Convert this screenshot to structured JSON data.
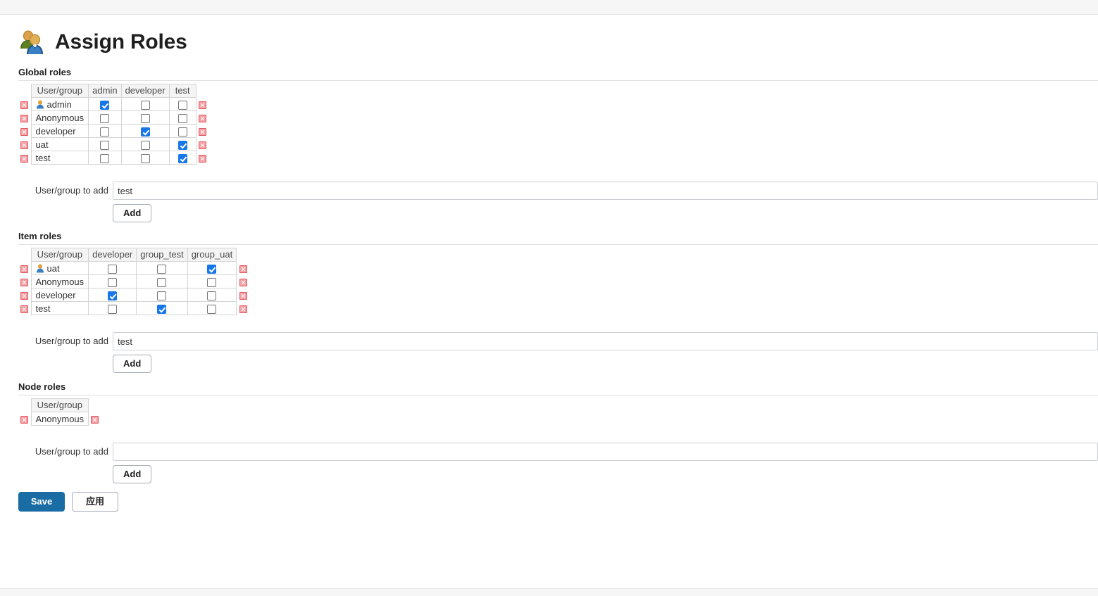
{
  "page": {
    "title": "Assign Roles",
    "title_icon": "users-group-icon"
  },
  "sections": [
    {
      "id": "global",
      "heading": "Global roles",
      "columns": [
        "User/group",
        "admin",
        "developer",
        "test"
      ],
      "rows": [
        {
          "name": "admin",
          "has_person_icon": true,
          "checks": [
            true,
            false,
            false
          ]
        },
        {
          "name": "Anonymous",
          "has_person_icon": false,
          "checks": [
            false,
            false,
            false
          ]
        },
        {
          "name": "developer",
          "has_person_icon": false,
          "checks": [
            false,
            true,
            false
          ]
        },
        {
          "name": "uat",
          "has_person_icon": false,
          "checks": [
            false,
            false,
            true
          ]
        },
        {
          "name": "test",
          "has_person_icon": false,
          "checks": [
            false,
            false,
            true
          ]
        }
      ],
      "add": {
        "label": "User/group to add",
        "value": "test",
        "placeholder": "",
        "button": "Add"
      }
    },
    {
      "id": "item",
      "heading": "Item roles",
      "columns": [
        "User/group",
        "developer",
        "group_test",
        "group_uat"
      ],
      "rows": [
        {
          "name": "uat",
          "has_person_icon": true,
          "checks": [
            false,
            false,
            true
          ]
        },
        {
          "name": "Anonymous",
          "has_person_icon": false,
          "checks": [
            false,
            false,
            false
          ]
        },
        {
          "name": "developer",
          "has_person_icon": false,
          "checks": [
            true,
            false,
            false
          ]
        },
        {
          "name": "test",
          "has_person_icon": false,
          "checks": [
            false,
            true,
            false
          ]
        }
      ],
      "add": {
        "label": "User/group to add",
        "value": "test",
        "placeholder": "",
        "button": "Add"
      }
    },
    {
      "id": "node",
      "heading": "Node roles",
      "columns": [
        "User/group"
      ],
      "rows": [
        {
          "name": "Anonymous",
          "has_person_icon": false,
          "checks": []
        }
      ],
      "add": {
        "label": "User/group to add",
        "value": "",
        "placeholder": "",
        "button": "Add"
      }
    }
  ],
  "actions": {
    "save_label": "Save",
    "apply_label": "应用"
  },
  "icons": {
    "delete_row": "delete-icon",
    "person": "person-icon"
  },
  "colors": {
    "primary_button": "#1a6ca4",
    "checkbox_checked": "#1877e8",
    "delete_icon": "#e05a62",
    "header_bg": "#f4f4f4",
    "chrome_bar": "#f6f6f6"
  }
}
